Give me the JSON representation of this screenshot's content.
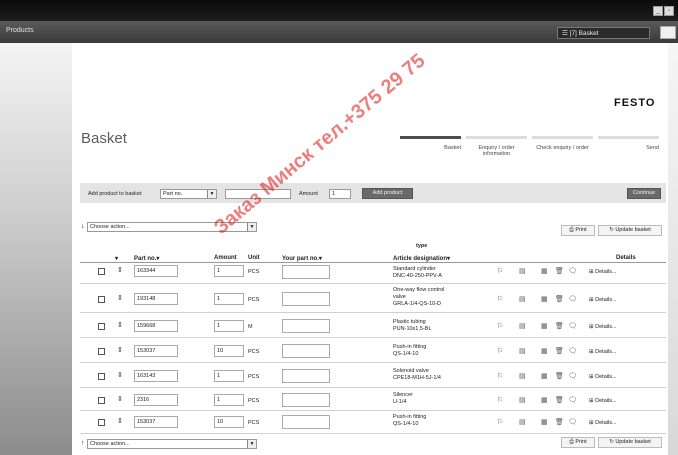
{
  "window": {
    "minimize": "_",
    "restore": "▫"
  },
  "nav": {
    "products": "Products",
    "basket_tab": "☲ [7] Basket"
  },
  "brand": "FESTO",
  "page": {
    "title": "Basket"
  },
  "steps": [
    {
      "label": "Basket",
      "active": true
    },
    {
      "label": "Enquiry / order information",
      "active": false
    },
    {
      "label": "Check enquiry / order",
      "active": false
    },
    {
      "label": "Send",
      "active": false
    }
  ],
  "add_bar": {
    "label": "Add product to basket",
    "search_by": "Part no.",
    "amount_label": "Amount",
    "amount_value": "1",
    "add_button": "Add product",
    "continue_button": "Continue"
  },
  "actions": {
    "choose_action": "Choose action...",
    "print": "Print",
    "update": "Update basket"
  },
  "table": {
    "headers": {
      "part_no": "Part no.▾",
      "amount": "Amount",
      "unit": "Unit",
      "your_part_no": "Your part no.▾",
      "type": "type",
      "article": "Article designation▾",
      "details": "Details"
    },
    "details_label": "Details...",
    "rows": [
      {
        "part_no": "163344",
        "amount": "1",
        "unit": "PCS",
        "lines": [
          "Standard cylinder",
          "DNC-40-250-PPV-A"
        ]
      },
      {
        "part_no": "193148",
        "amount": "1",
        "unit": "PCS",
        "lines": [
          "One-way flow control",
          "valve",
          "GRLA-1/4-QS-10-D"
        ]
      },
      {
        "part_no": "159668",
        "amount": "1",
        "unit": "M",
        "lines": [
          "Plastic tubing",
          "PUN-10x1,5-BL"
        ]
      },
      {
        "part_no": "153037",
        "amount": "10",
        "unit": "PCS",
        "lines": [
          "Push-in fitting",
          "QS-1/4-10"
        ]
      },
      {
        "part_no": "163143",
        "amount": "1",
        "unit": "PCS",
        "lines": [
          "Solenoid valve",
          "CPE18-M1H-5J-1/4"
        ]
      },
      {
        "part_no": "2316",
        "amount": "1",
        "unit": "PCS",
        "lines": [
          "Silencer",
          "U-1/4"
        ]
      },
      {
        "part_no": "153037",
        "amount": "10",
        "unit": "PCS",
        "lines": [
          "Push-in fitting",
          "QS-1/4-10"
        ]
      }
    ]
  },
  "watermark": "Заказ Минск тел.+375 29 75"
}
